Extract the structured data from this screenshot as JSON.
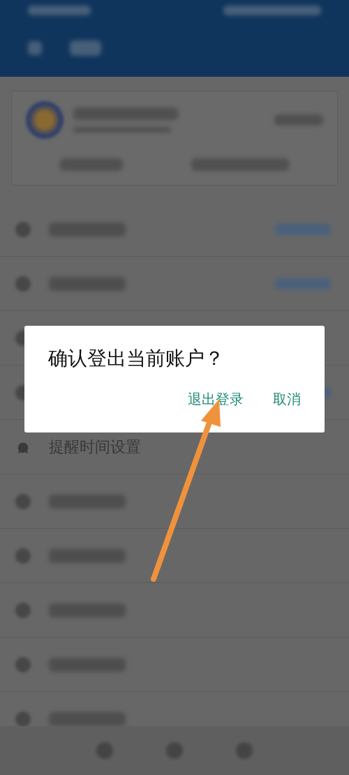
{
  "background_rows": [
    {
      "kind": "blurred_value"
    },
    {
      "kind": "blurred_value"
    },
    {
      "kind": "covered"
    },
    {
      "kind": "covered_value"
    },
    {
      "kind": "text",
      "label": "提醒时间设置"
    },
    {
      "kind": "blurred"
    },
    {
      "kind": "blurred"
    },
    {
      "kind": "blurred"
    },
    {
      "kind": "blurred"
    },
    {
      "kind": "blurred"
    }
  ],
  "dialog": {
    "message": "确认登出当前账户？",
    "buttons": [
      "退出登录",
      "取消"
    ]
  },
  "annotation": {
    "kind": "arrow"
  }
}
